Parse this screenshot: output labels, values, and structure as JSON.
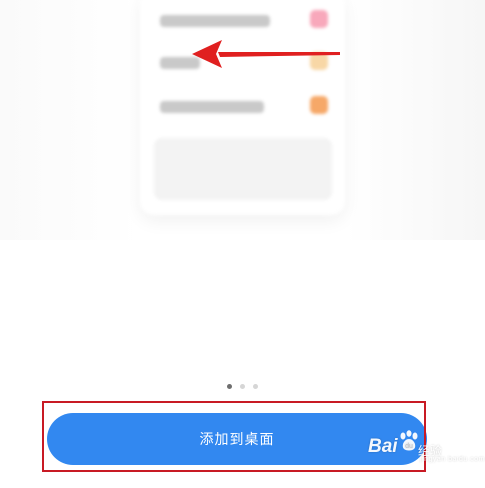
{
  "widget_preview": {
    "items": [
      {
        "color": "#f8a8bb"
      },
      {
        "color": "#f8d7a6"
      },
      {
        "color": "#f6a868"
      }
    ]
  },
  "annotation": {
    "arrow_color": "#e02020"
  },
  "pager": {
    "pages": 3,
    "active": 1
  },
  "add_to_desktop_button": {
    "label": "添加到桌面",
    "color": "#3288f0",
    "highlight_color": "#c81a24"
  },
  "watermark": {
    "brand": "Bai",
    "suffix": "经验",
    "sub": "jingyan.baidu.com"
  }
}
